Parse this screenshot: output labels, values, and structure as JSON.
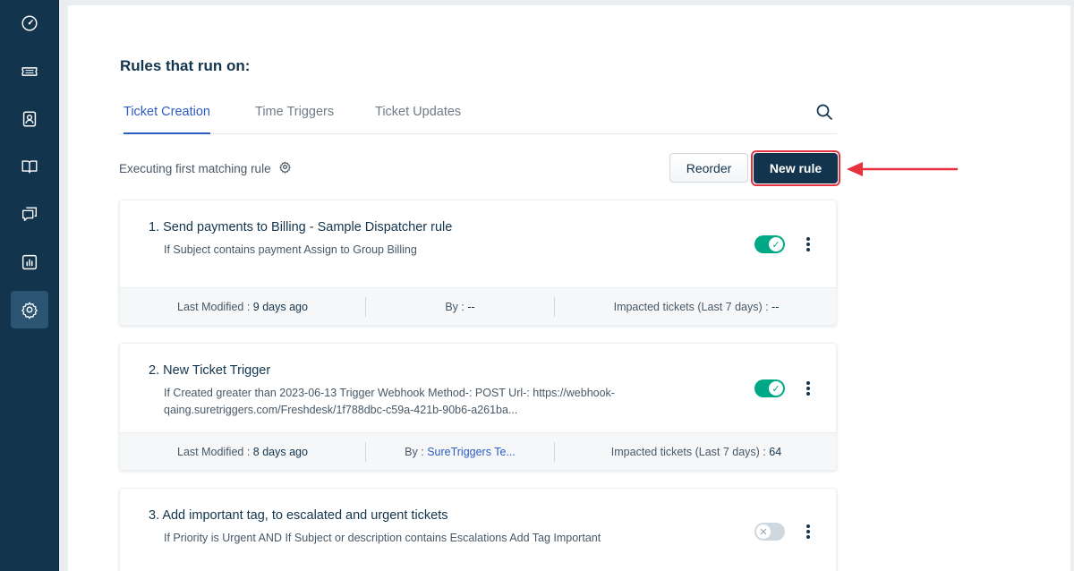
{
  "sidebar": {
    "items": [
      {
        "icon": "dashboard-icon"
      },
      {
        "icon": "ticket-icon"
      },
      {
        "icon": "contacts-icon"
      },
      {
        "icon": "solutions-book-icon"
      },
      {
        "icon": "discussions-icon"
      },
      {
        "icon": "reports-icon"
      },
      {
        "icon": "admin-gear-icon",
        "active": true
      }
    ]
  },
  "page": {
    "title": "Rules that run on:",
    "tabs": [
      {
        "label": "Ticket Creation",
        "active": true
      },
      {
        "label": "Time Triggers"
      },
      {
        "label": "Ticket Updates"
      }
    ],
    "execution_mode": "Executing first matching rule",
    "reorder_label": "Reorder",
    "new_rule_label": "New rule"
  },
  "rules": [
    {
      "title": "1. Send payments to Billing - Sample Dispatcher rule",
      "description": "If Subject contains payment Assign to Group Billing",
      "enabled": true,
      "last_modified_label": "Last Modified :",
      "last_modified": "9 days ago",
      "by_label": "By :",
      "by": "--",
      "impacted_label": "Impacted tickets (Last 7 days) :",
      "impacted": "--"
    },
    {
      "title": "2. New Ticket Trigger",
      "description": "If Created greater than 2023-06-13 Trigger Webhook Method-: POST Url-: https://webhook-qaing.suretriggers.com/Freshdesk/1f788dbc-c59a-421b-90b6-a261ba...",
      "enabled": true,
      "last_modified_label": "Last Modified :",
      "last_modified": "8 days ago",
      "by_label": "By :",
      "by": "SureTriggers Te...",
      "impacted_label": "Impacted tickets (Last 7 days) :",
      "impacted": "64"
    },
    {
      "title": "3. Add important tag, to escalated and urgent tickets",
      "description": "If Priority is Urgent AND If Subject or description contains Escalations Add Tag Important",
      "enabled": false
    }
  ],
  "colors": {
    "sidebar": "#12344d",
    "accent": "#2c5cc5",
    "toggle_on": "#00a886",
    "highlight": "#e5323e"
  }
}
